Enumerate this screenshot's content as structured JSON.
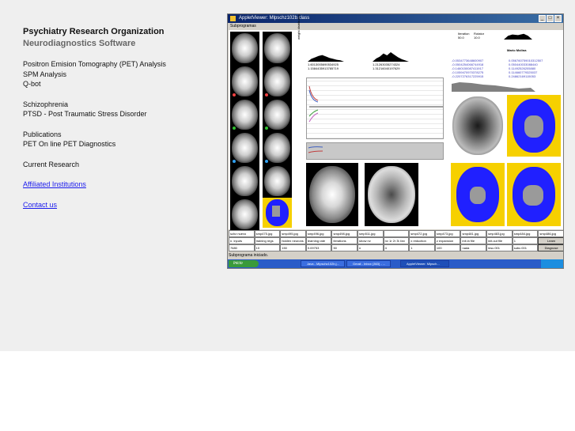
{
  "header": {
    "org_title": "Psychiatry Research Organization",
    "org_subtitle": "Neurodiagnostics Software"
  },
  "nav": {
    "group1": [
      "Positron Emision Tomography (PET) Analysis",
      "SPM Analysis",
      "Q-bot"
    ],
    "group2": [
      "Schizophrenia",
      "PTSD - Post Traumatic Stress Disorder"
    ],
    "group3": [
      "Publications",
      "PET On line PET Diagnostics"
    ],
    "group4": [
      "Current Research"
    ],
    "affiliated": "Affiliated Institutions",
    "contact": "Contact us"
  },
  "applet": {
    "window_title": "AppletViewer: Mlpschz102b.class",
    "subprogramas_label": "Subprogramas",
    "status_text": "Subprograma iniciado.",
    "hist1_label": "1.6013005690534925\n1.1584435913785719",
    "hist2_label": "1.21263035274324\n1.31216040197629",
    "ylabel": "weight distribution",
    "iteration_label": "Iteration",
    "iteration_value": "50.0",
    "rotator_label": "Rotator",
    "rotator_value": "10.0",
    "person_name": "Mario Molina",
    "table": {
      "row1": [
        "schz nuevo",
        "smp475.jpg",
        "smp495.jpg",
        "smp496.jpg",
        "smp498.jpg",
        "smp511.jpg",
        "",
        "smp472.jpg",
        "smp473.jpg",
        "smp481.jpg",
        "smp483.jpg",
        "smp484.jpg",
        "smp486.jpg"
      ],
      "row2": [
        "n. inputs",
        "training regs",
        "hidden neurons",
        "learning rate",
        "iterations",
        "show nv",
        "nv 1r 2r 3l 4nv",
        "x reduction",
        "z expansion",
        "init.in file",
        "init.out file",
        "1",
        "Learn"
      ],
      "row3": [
        "7680",
        "10",
        "150",
        "0.09753",
        "50",
        "n",
        "4",
        "1",
        "100",
        "nada",
        "insc.001",
        "subc.001",
        "Diagnose"
      ]
    },
    "taskbar": {
      "start": "Inicio",
      "tasks": [
        "Java - Mlpschz102b.j...",
        "Gmail - Inbox (363) - ...",
        "AppletViewer: Mlpsch..."
      ]
    }
  },
  "colors": {
    "link": "#1a1aee",
    "subtitle": "#666666",
    "band": "#efefef",
    "blue_map": "#2020ff",
    "yellow_map": "#f6d000"
  }
}
